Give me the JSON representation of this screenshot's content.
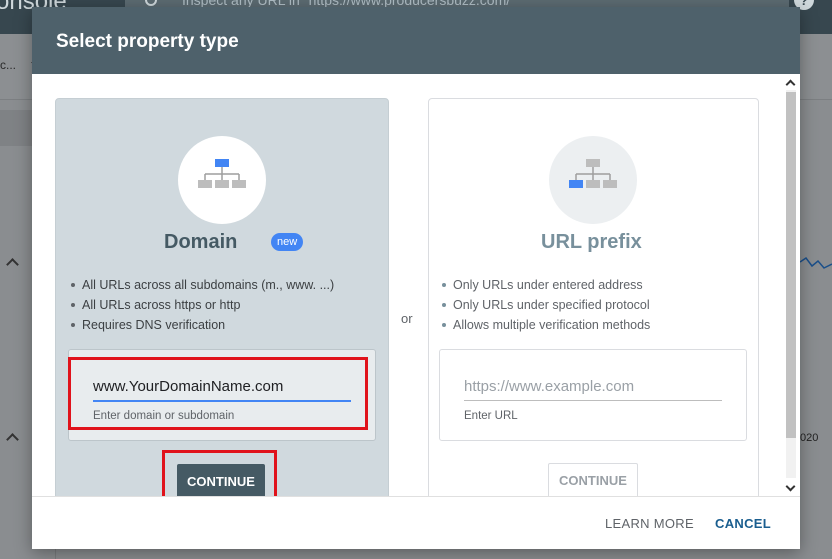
{
  "background": {
    "app_title": "onsole",
    "search_text": "Inspect any URL in \"https://www.producersbuzz.com/\"",
    "help_glyph": "?",
    "property_selector_text": "c...",
    "right_year": "020"
  },
  "dialog": {
    "title": "Select property type",
    "or_label": "or",
    "domain": {
      "title": "Domain",
      "badge": "new",
      "bullets": [
        "All URLs across all subdomains (m., www. ...)",
        "All URLs across https or http",
        "Requires DNS verification"
      ],
      "input_value": "www.YourDomainName.com",
      "input_helper": "Enter domain or subdomain",
      "continue_label": "CONTINUE"
    },
    "url_prefix": {
      "title": "URL prefix",
      "bullets": [
        "Only URLs under entered address",
        "Only URLs under specified protocol",
        "Allows multiple verification methods"
      ],
      "input_placeholder": "https://www.example.com",
      "input_helper": "Enter URL",
      "continue_label": "CONTINUE"
    },
    "footer": {
      "learn_more": "LEARN MORE",
      "cancel": "CANCEL"
    }
  },
  "colors": {
    "header": "#4e616b",
    "accent_blue": "#4285f4",
    "highlight_red": "#e0121b",
    "domain_card_bg": "#d0d9de",
    "primary_button": "#455a64"
  }
}
